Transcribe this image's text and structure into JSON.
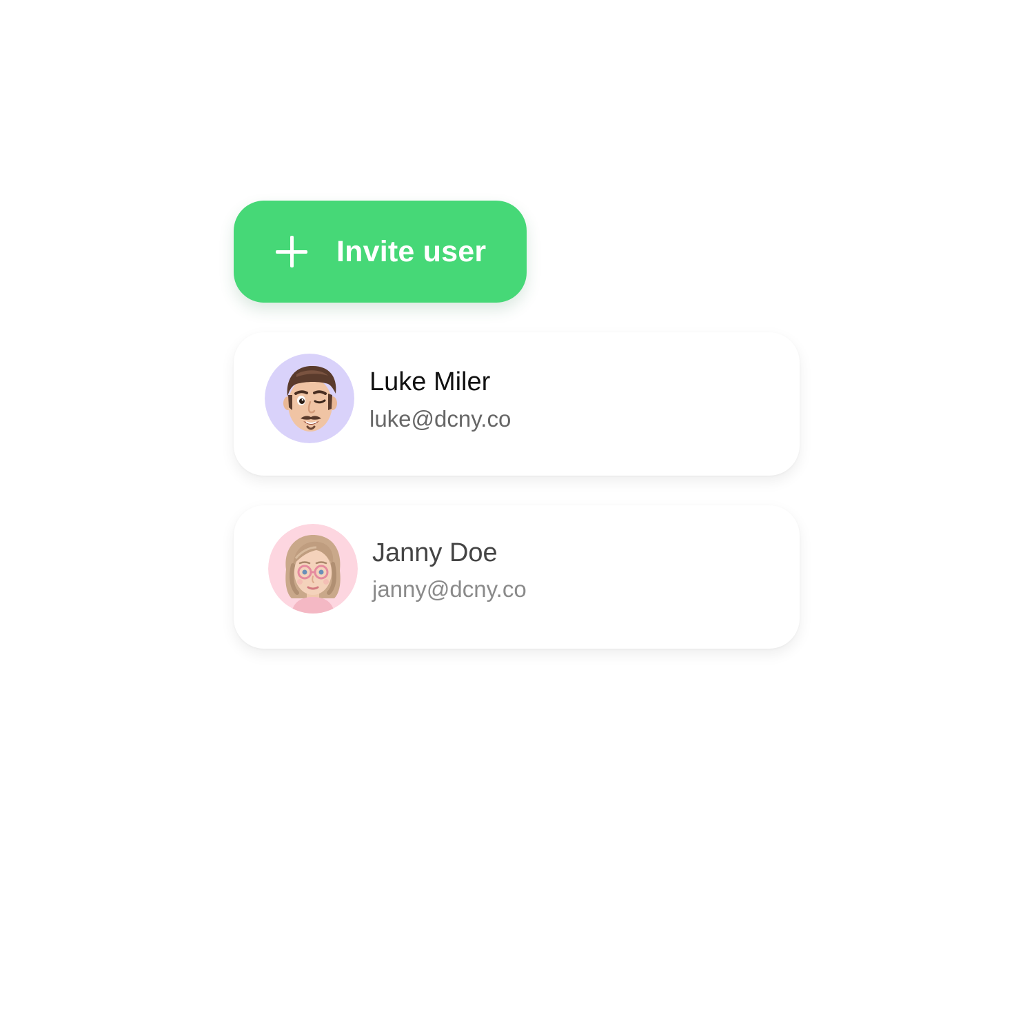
{
  "invite_button": {
    "label": "Invite user",
    "icon": "plus-icon",
    "color": "#46d877"
  },
  "users": [
    {
      "name": "Luke Miler",
      "email": "luke@dcny.co",
      "avatar_bg": "#d9d2fa"
    },
    {
      "name": "Janny Doe",
      "email": "janny@dcny.co",
      "avatar_bg": "#fdd6e0"
    }
  ]
}
